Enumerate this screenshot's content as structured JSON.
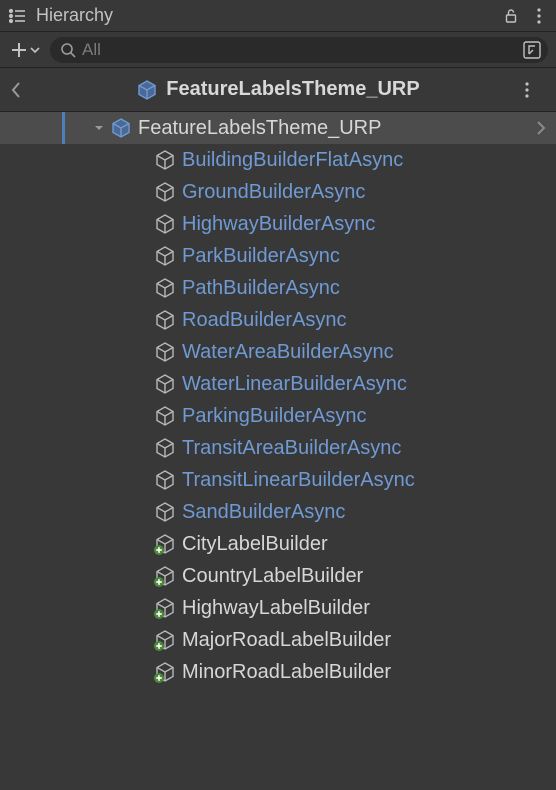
{
  "panel": {
    "title": "Hierarchy"
  },
  "search": {
    "placeholder": "All"
  },
  "breadcrumb": {
    "title": "FeatureLabelsTheme_URP"
  },
  "root": {
    "label": "FeatureLabelsTheme_URP",
    "expanded": true,
    "selected": true
  },
  "children": [
    {
      "label": "BuildingBuilderFlatAsync",
      "kind": "prefab",
      "added": false
    },
    {
      "label": "GroundBuilderAsync",
      "kind": "prefab",
      "added": false
    },
    {
      "label": "HighwayBuilderAsync",
      "kind": "prefab",
      "added": false
    },
    {
      "label": "ParkBuilderAsync",
      "kind": "prefab",
      "added": false
    },
    {
      "label": "PathBuilderAsync",
      "kind": "prefab",
      "added": false
    },
    {
      "label": "RoadBuilderAsync",
      "kind": "prefab",
      "added": false
    },
    {
      "label": "WaterAreaBuilderAsync",
      "kind": "prefab",
      "added": false
    },
    {
      "label": "WaterLinearBuilderAsync",
      "kind": "prefab",
      "added": false
    },
    {
      "label": "ParkingBuilderAsync",
      "kind": "prefab",
      "added": false
    },
    {
      "label": "TransitAreaBuilderAsync",
      "kind": "prefab",
      "added": false
    },
    {
      "label": "TransitLinearBuilderAsync",
      "kind": "prefab",
      "added": false
    },
    {
      "label": "SandBuilderAsync",
      "kind": "prefab",
      "added": false
    },
    {
      "label": "CityLabelBuilder",
      "kind": "normal",
      "added": true
    },
    {
      "label": "CountryLabelBuilder",
      "kind": "normal",
      "added": true
    },
    {
      "label": "HighwayLabelBuilder",
      "kind": "normal",
      "added": true
    },
    {
      "label": "MajorRoadLabelBuilder",
      "kind": "normal",
      "added": true
    },
    {
      "label": "MinorRoadLabelBuilder",
      "kind": "normal",
      "added": true
    }
  ],
  "colors": {
    "prefab_text": "#6f9ad3",
    "normal_text": "#d7d7d7",
    "bg": "#383838",
    "selected_bg": "#4c4c4c",
    "accent": "#4d7fbf"
  }
}
